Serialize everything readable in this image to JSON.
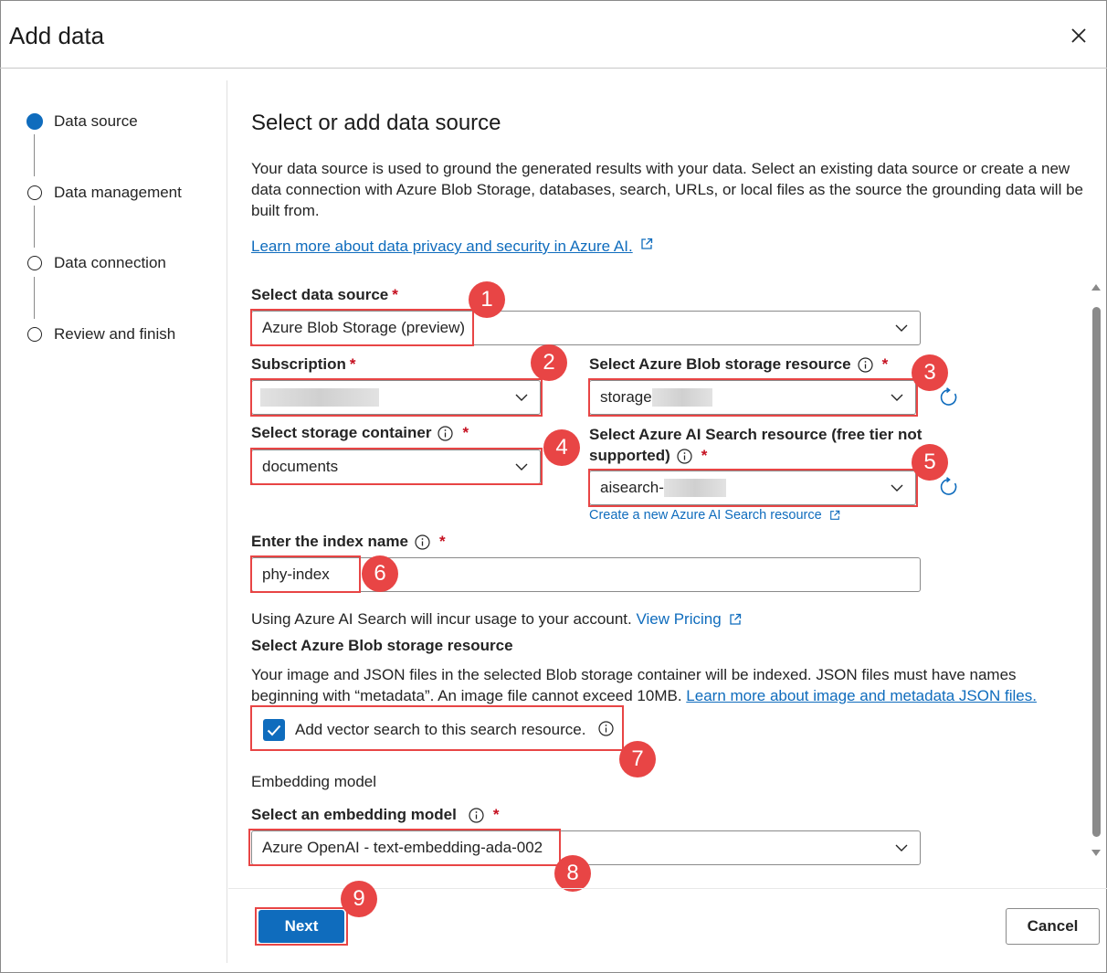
{
  "dialog": {
    "title": "Add data"
  },
  "steps": [
    {
      "label": "Data source",
      "active": true
    },
    {
      "label": "Data management",
      "active": false
    },
    {
      "label": "Data connection",
      "active": false
    },
    {
      "label": "Review and finish",
      "active": false
    }
  ],
  "main": {
    "heading": "Select or add data source",
    "description": "Your data source is used to ground the generated results with your data. Select an existing data source or create a new data connection with Azure Blob Storage, databases, search, URLs, or local files as the source the grounding data will be built from.",
    "privacy_link": "Learn more about data privacy and security in Azure AI."
  },
  "form": {
    "data_source": {
      "label": "Select data source",
      "required": "*",
      "value": "Azure Blob Storage (preview)"
    },
    "subscription": {
      "label": "Subscription",
      "required": "*",
      "value": ""
    },
    "blob_resource": {
      "label": "Select Azure Blob storage resource",
      "required": "*",
      "value": "storage"
    },
    "container": {
      "label": "Select storage container",
      "required": "*",
      "value": "documents"
    },
    "search_resource": {
      "label_line1": "Select Azure AI Search resource (free tier not",
      "label_line2": "supported)",
      "required": "*",
      "value": "aisearch-",
      "create_link": "Create a new Azure AI Search resource"
    },
    "index_name": {
      "label": "Enter the index name",
      "required": "*",
      "value": "phy-index"
    },
    "usage_note": "Using Azure AI Search will incur usage to your account.",
    "pricing_link": "View Pricing",
    "blob_section_title": "Select Azure Blob storage resource",
    "blob_section_text": "Your image and JSON files in the selected Blob storage container will be indexed. JSON files must have names beginning with “metadata”. An image file cannot exceed 10MB.",
    "blob_section_link": "Learn more about image and metadata JSON files.",
    "vector_search": {
      "label": "Add vector search to this search resource.",
      "checked": true
    },
    "embedding_section": "Embedding model",
    "embedding_model": {
      "label": "Select an embedding model",
      "required": "*",
      "value": "Azure OpenAI - text-embedding-ada-002"
    }
  },
  "annotations": [
    "1",
    "2",
    "3",
    "4",
    "5",
    "6",
    "7",
    "8",
    "9"
  ],
  "footer": {
    "next_label": "Next",
    "cancel_label": "Cancel"
  },
  "colors": {
    "accent": "#0f6cbd",
    "annotation": "#e84545",
    "required": "#c50f1f"
  }
}
